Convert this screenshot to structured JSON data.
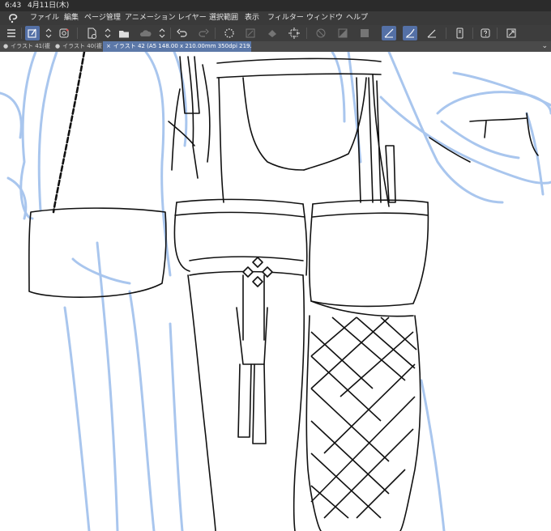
{
  "status": {
    "time": "6:43",
    "date": "4月11日(木)"
  },
  "menu": {
    "items": [
      "ファイル",
      "編集",
      "ページ管理",
      "アニメーション",
      "レイヤー",
      "選択範囲",
      "表示",
      "フィルター",
      "ウィンドウ",
      "ヘルプ"
    ]
  },
  "toolbar": {
    "icons": [
      "menu-icon",
      "new-canvas-icon",
      "stepper-icon",
      "eye-icon",
      "new-page-icon",
      "stepper-icon",
      "open-folder-icon",
      "cloud-icon",
      "stepper-icon",
      "undo-icon",
      "redo-icon",
      "loading-spinner-icon",
      "clear-icon",
      "fill-icon",
      "crop-icon",
      "snap-icon",
      "layer-mask-icon",
      "fill-rect-icon",
      "pen-ruler-icon",
      "pen-icon",
      "ruler-icon",
      "phone-icon",
      "help-icon",
      "expand-icon"
    ]
  },
  "tabs": [
    {
      "label": "イラスト 41(複",
      "active": false
    },
    {
      "label": "イラスト 40(複",
      "active": false
    },
    {
      "label": "イラスト 42 (A5 148.00 x 210.00mm 350dpi 219.8%)",
      "active": true
    }
  ],
  "canvas": {
    "background": "#ffffff",
    "sketch_color": "#a9c6ee",
    "line_color": "#111111"
  }
}
